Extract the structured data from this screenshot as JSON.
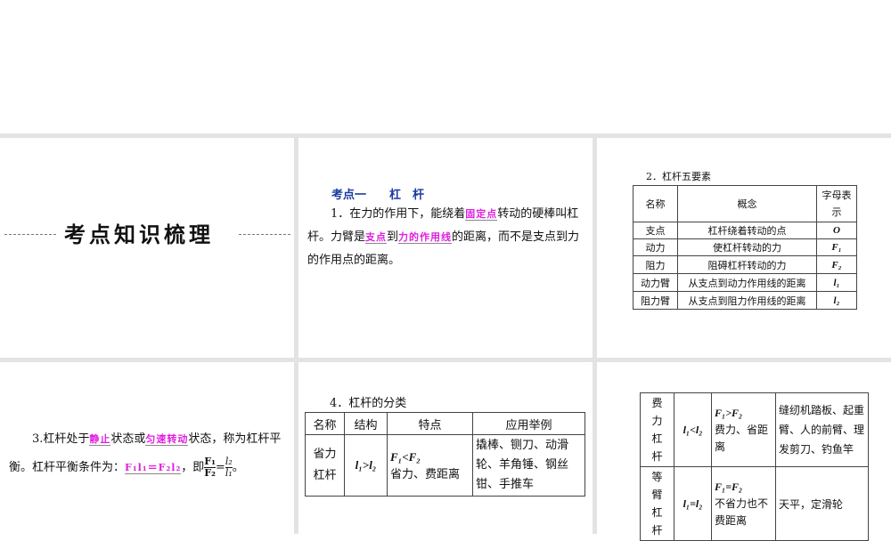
{
  "title": "考点知识梳理",
  "p1": {
    "heading": "考点一　　杠　杆",
    "t1": "1．在力的作用下，能绕着",
    "h1": "固定点",
    "t2": "转动的硬棒叫杠杆。力臂是",
    "h2": "支点",
    "t3": "到",
    "h3": "力的作用线",
    "t4": "的距离，而不是支点到力的作用点的距离。"
  },
  "t2": {
    "heading": "2．杠杆五要素",
    "headers": [
      "名称",
      "概念",
      "字母表示"
    ],
    "rows": [
      [
        "支点",
        "杠杆绕着转动的点",
        "O"
      ],
      [
        "动力",
        "使杠杆转动的力",
        "F₁"
      ],
      [
        "阻力",
        "阻碍杠杆转动的力",
        "F₂"
      ],
      [
        "动力臂",
        "从支点到动力作用线的距离",
        "l₁"
      ],
      [
        "阻力臂",
        "从支点到阻力作用线的距离",
        "l₂"
      ]
    ]
  },
  "p3": {
    "t1": "3.杠杆处于",
    "h1": "静止",
    "t2": "状态或",
    "h2": "匀速转动",
    "t3": "状态，称为杠杆平衡。杠杆平衡条件为：",
    "h3": "F₁l₁＝F₂l₂",
    "t4": "，即",
    "num1": "F₁",
    "den1": "F₂",
    "eq": "=",
    "num2": "l₂",
    "den2": "l₁",
    "end": "。"
  },
  "t4": {
    "heading": "4．杠杆的分类",
    "headers": [
      "名称",
      "结构",
      "特点",
      "应用举例"
    ],
    "rows": [
      [
        "省力杠杆",
        "l₁>l₂",
        "F₁<F₂",
        "省力、费距离",
        "撬棒、铡刀、动滑轮、羊角锤、钢丝钳、手推车"
      ]
    ]
  },
  "t5": {
    "rows": [
      [
        "费力杠杆",
        "l₁<l₂",
        "F₁>F₂",
        "费力、省距离",
        "缝纫机踏板、起重臂、人的前臂、理发剪刀、钓鱼竿"
      ],
      [
        "等臂杠杆",
        "l₁=l₂",
        "F₁=F₂",
        "不省力也不费距离",
        "天平，定滑轮"
      ]
    ]
  }
}
